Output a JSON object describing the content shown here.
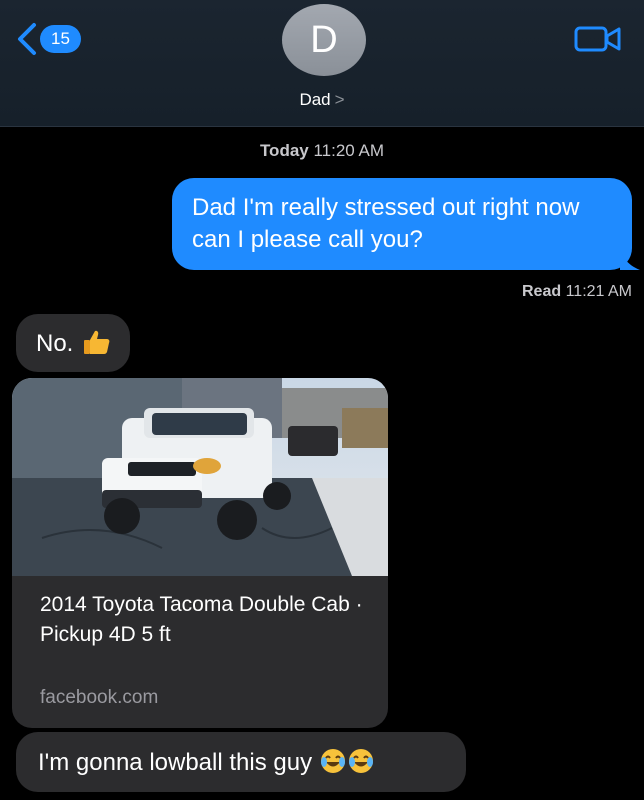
{
  "header": {
    "back_count": "15",
    "avatar_initial": "D",
    "contact_name": "Dad",
    "contact_chevron": ">"
  },
  "thread": {
    "timestamp_day": "Today",
    "timestamp_time": "11:20 AM",
    "outgoing_message": "Dad I'm really stressed out right now can I please call you?",
    "read_label": "Read",
    "read_time": "11:21 AM",
    "reply_1": "No.",
    "reply_1_emoji": "thumbs-up-icon",
    "link_preview": {
      "title": "2014 Toyota Tacoma Double Cab · Pickup 4D 5 ft",
      "domain": "facebook.com"
    },
    "reply_2": "I'm gonna lowball this guy",
    "reply_2_emojis": [
      "crying-laughing-icon",
      "crying-laughing-icon"
    ]
  },
  "colors": {
    "outgoing_bubble": "#1f8bff",
    "incoming_bubble": "#2c2c2e",
    "background": "#000000",
    "header": "#1b2530"
  }
}
